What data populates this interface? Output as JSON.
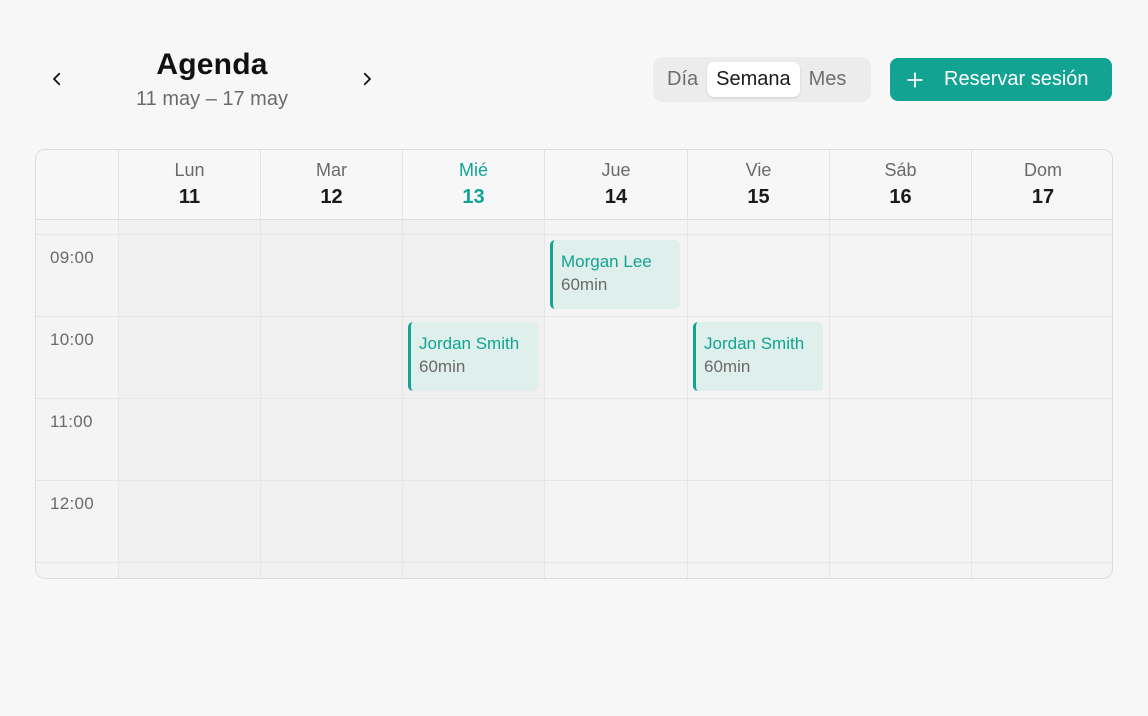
{
  "header": {
    "title": "Agenda",
    "range": "11 may – 17 may",
    "prev_icon": "chevron-left-icon",
    "next_icon": "chevron-right-icon"
  },
  "view_switch": {
    "options": [
      "Día",
      "Semana",
      "Mes"
    ],
    "selected": "Semana"
  },
  "cta": {
    "label": "Reservar sesión",
    "icon": "plus-icon"
  },
  "calendar": {
    "days": [
      {
        "name": "Lun",
        "num": "11"
      },
      {
        "name": "Mar",
        "num": "12"
      },
      {
        "name": "Mié",
        "num": "13",
        "today": true
      },
      {
        "name": "Jue",
        "num": "14"
      },
      {
        "name": "Vie",
        "num": "15"
      },
      {
        "name": "Sáb",
        "num": "16"
      },
      {
        "name": "Dom",
        "num": "17"
      }
    ],
    "hours": [
      "09:00",
      "10:00",
      "11:00",
      "12:00"
    ],
    "events": [
      {
        "name": "Morgan Lee",
        "duration": "60min",
        "day": "Jue",
        "start": "09:00"
      },
      {
        "name": "Jordan Smith",
        "duration": "60min",
        "day": "Mié",
        "start": "10:00"
      },
      {
        "name": "Jordan Smith",
        "duration": "60min",
        "day": "Vie",
        "start": "10:00"
      }
    ]
  },
  "colors": {
    "accent": "#12a392",
    "event_bg": "#deefec",
    "background": "#f7f7f7"
  }
}
